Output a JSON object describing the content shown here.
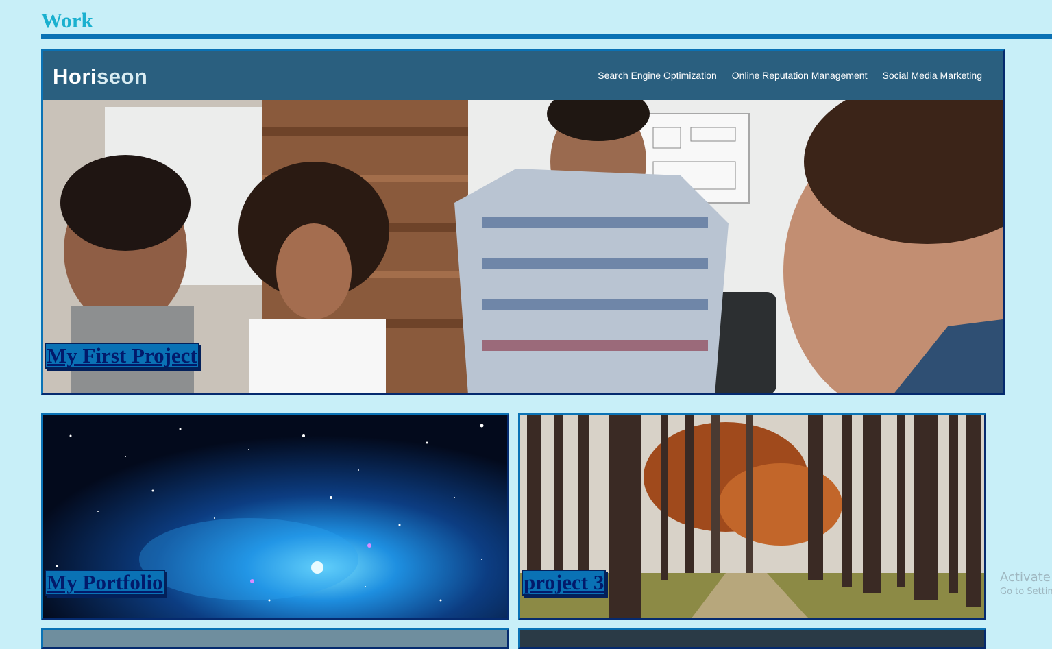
{
  "section": {
    "title": "Work"
  },
  "projects": [
    {
      "label": "My First Project",
      "header": {
        "brand_a": "Hori",
        "brand_b": "seon",
        "nav": [
          "Search Engine Optimization",
          "Online Reputation Management",
          "Social Media Marketing"
        ]
      }
    },
    {
      "label": "My Portfolio"
    },
    {
      "label": "project 3"
    }
  ],
  "watermark": {
    "line1": "Activate",
    "line2": "Go to Settin"
  },
  "colors": {
    "background": "#c8eff8",
    "accent": "#0a72b5",
    "title": "#1ab0cf",
    "label_text": "#021a6b",
    "header": "#2a5f7f"
  }
}
